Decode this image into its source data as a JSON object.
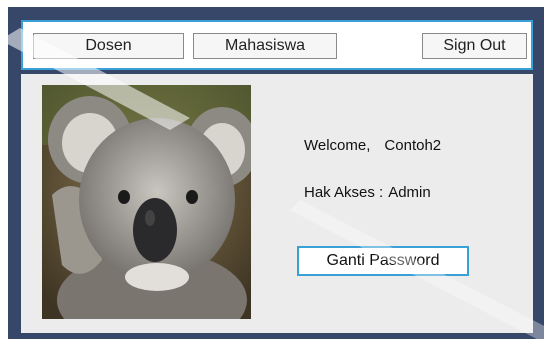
{
  "nav": {
    "dosen_label": "Dosen",
    "mahasiswa_label": "Mahasiswa",
    "signout_label": "Sign Out"
  },
  "profile": {
    "welcome_label": "Welcome,",
    "username": "Contoh2",
    "akses_label": "Hak Akses :",
    "akses_value": "Admin",
    "photo_icon": "koala-photo"
  },
  "actions": {
    "ganti_password_label": "Ganti Password"
  },
  "colors": {
    "frame": "#37476a",
    "accent": "#3aa0d8",
    "panel": "#ececec"
  }
}
